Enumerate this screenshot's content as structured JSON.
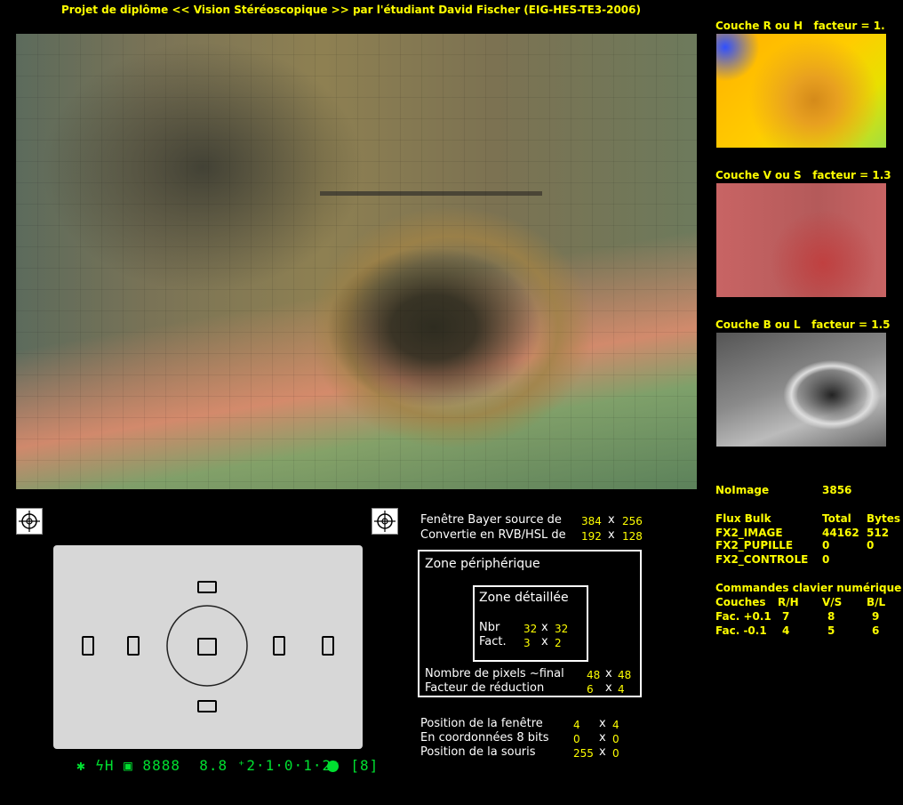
{
  "title": "Projet de diplôme << Vision Stéréoscopique >> par l'étudiant David Fischer (EIG-HES-TE3-2006)",
  "layers": [
    {
      "label": "Couche R ou H",
      "factor_label": "facteur = 1."
    },
    {
      "label": "Couche V ou S",
      "factor_label": "facteur = 1.3"
    },
    {
      "label": "Couche B ou L",
      "factor_label": "facteur = 1.5"
    }
  ],
  "bayer": {
    "source_label": "Fenêtre Bayer source de",
    "source_w": "384",
    "source_x": "x",
    "source_h": "256",
    "converted_label": "Convertie en RVB/HSL de",
    "converted_w": "192",
    "converted_x": "x",
    "converted_h": "128"
  },
  "zone_peripherique": {
    "title": "Zone périphérique",
    "pixels_label": "Nombre de pixels ~final",
    "pixels_w": "48",
    "pixels_x": "x",
    "pixels_h": "48",
    "reduction_label": "Facteur de réduction",
    "reduction_w": "6",
    "reduction_x": "x",
    "reduction_h": "4"
  },
  "zone_detaillee": {
    "title": "Zone détaillée",
    "nbr_label": "Nbr",
    "nbr_w": "32",
    "nbr_x": "x",
    "nbr_h": "32",
    "fact_label": "Fact.",
    "fact_w": "3",
    "fact_x": "x",
    "fact_h": "2"
  },
  "positions": {
    "window_label": "Position de la fenêtre",
    "window_x_val": "4",
    "window_sep": "x",
    "window_y_val": "4",
    "coords_label": "En coordonnées 8 bits",
    "coords_x_val": "0",
    "coords_sep": "x",
    "coords_y_val": "0",
    "mouse_label": "Position de la souris",
    "mouse_x_val": "255",
    "mouse_sep": "x",
    "mouse_y_val": "0"
  },
  "noimage": {
    "label": "NoImage",
    "value": "3856"
  },
  "flux": {
    "header": {
      "name": "Flux Bulk",
      "total": "Total",
      "bytes": "Bytes"
    },
    "rows": [
      {
        "name": "FX2_IMAGE",
        "total": "44162",
        "bytes": "512"
      },
      {
        "name": "FX2_PUPILLE",
        "total": "0",
        "bytes": "0"
      },
      {
        "name": "FX2_CONTROLE",
        "total": "0",
        "bytes": ""
      }
    ]
  },
  "commands": {
    "title": "Commandes clavier numérique",
    "header": {
      "name": "Couches",
      "rh": "R/H",
      "vs": "V/S",
      "bl": "B/L"
    },
    "rows": [
      {
        "name": "Fac. +0.1",
        "rh": "7",
        "vs": "8",
        "bl": "9"
      },
      {
        "name": "Fac. -0.1",
        "rh": "4",
        "vs": "5",
        "bl": "6"
      }
    ]
  },
  "lcd": {
    "readout": "✱ ϟH ▣ 8888  8.8 ⁺2·1·0·1·2⁺ [8]"
  },
  "icons": {
    "crosshair": "crosshair-icon",
    "af_point": "af-point-icon"
  }
}
